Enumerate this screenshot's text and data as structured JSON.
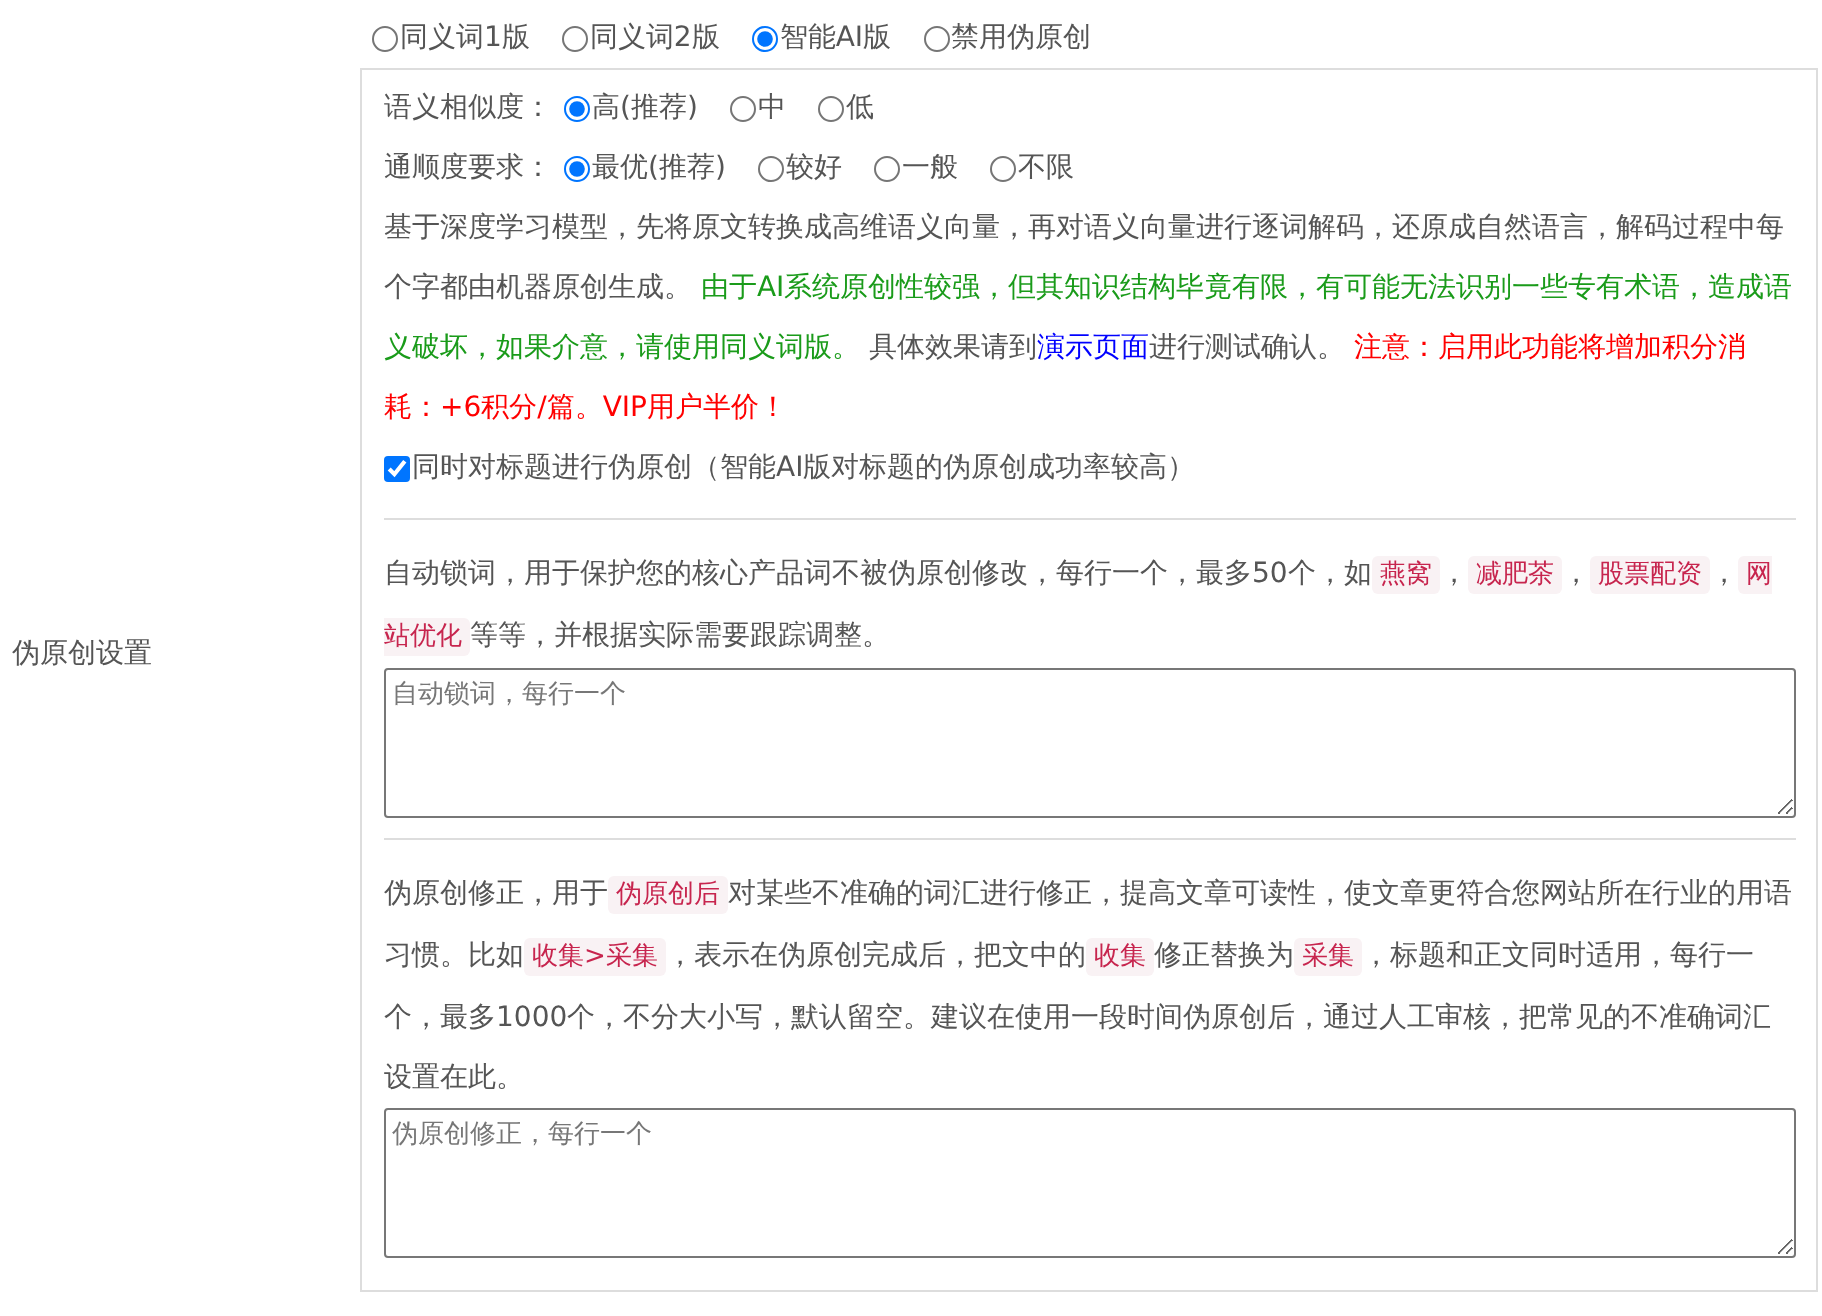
{
  "mode_options": [
    {
      "label": "同义词1版",
      "selected": false
    },
    {
      "label": "同义词2版",
      "selected": false
    },
    {
      "label": "智能AI版",
      "selected": true
    },
    {
      "label": "禁用伪原创",
      "selected": false
    }
  ],
  "ai_settings": {
    "similarity": {
      "label": "语义相似度：",
      "options": [
        {
          "label": "高(推荐)",
          "selected": true
        },
        {
          "label": "中",
          "selected": false
        },
        {
          "label": "低",
          "selected": false
        }
      ]
    },
    "fluency": {
      "label": "通顺度要求：",
      "options": [
        {
          "label": "最优(推荐)",
          "selected": true
        },
        {
          "label": "较好",
          "selected": false
        },
        {
          "label": "一般",
          "selected": false
        },
        {
          "label": "不限",
          "selected": false
        }
      ]
    },
    "description": [
      {
        "kind": "plain",
        "text": "基于深度学习模型，先将原文转换成高维语义向量，再对语义向量进行逐词解码，还原成自然语言，解码过程中每个字都由机器原创生成。 "
      },
      {
        "kind": "green",
        "text": "由于AI系统原创性较强，但其知识结构毕竟有限，有可能无法识别一些专有术语，造成语义破坏，如果介意，请使用同义词版。"
      },
      {
        "kind": "plain",
        "text": " 具体效果请到"
      },
      {
        "kind": "link",
        "text": "演示页面"
      },
      {
        "kind": "plain",
        "text": "进行测试确认。 "
      },
      {
        "kind": "warning",
        "text": "注意：启用此功能将增加积分消耗：+6积分/篇。VIP用户半价！"
      }
    ],
    "title_checkbox": {
      "label": "同时对标题进行伪原创（智能AI版对标题的伪原创成功率较高）",
      "checked": true
    }
  },
  "side_label": "伪原创设置",
  "lock_words": {
    "description": [
      {
        "kind": "plain",
        "text": "自动锁词，用于保护您的核心产品词不被伪原创修改，每行一个，最多50个，如"
      },
      {
        "kind": "code",
        "text": "燕窝"
      },
      {
        "kind": "plain",
        "text": "，"
      },
      {
        "kind": "code",
        "text": "减肥茶"
      },
      {
        "kind": "plain",
        "text": "，"
      },
      {
        "kind": "code",
        "text": "股票配资"
      },
      {
        "kind": "plain",
        "text": "，"
      },
      {
        "kind": "code",
        "text": "网站优化"
      },
      {
        "kind": "plain",
        "text": "等等，并根据实际需要跟踪调整。"
      }
    ],
    "placeholder": "自动锁词，每行一个"
  },
  "corrections": {
    "description": [
      {
        "kind": "plain",
        "text": "伪原创修正，用于"
      },
      {
        "kind": "code",
        "text": "伪原创后"
      },
      {
        "kind": "plain",
        "text": "对某些不准确的词汇进行修正，提高文章可读性，使文章更符合您网站所在行业的用语习惯。比如"
      },
      {
        "kind": "code",
        "text": "收集>采集"
      },
      {
        "kind": "plain",
        "text": "，表示在伪原创完成后，把文中的"
      },
      {
        "kind": "code",
        "text": "收集"
      },
      {
        "kind": "plain",
        "text": "修正替换为"
      },
      {
        "kind": "code",
        "text": "采集"
      },
      {
        "kind": "plain",
        "text": "，标题和正文同时适用，每行一个，最多1000个，不分大小写，默认留空。建议在使用一段时间伪原创后，通过人工审核，把常见的不准确词汇设置在此。"
      }
    ],
    "placeholder": "伪原创修正，每行一个"
  }
}
